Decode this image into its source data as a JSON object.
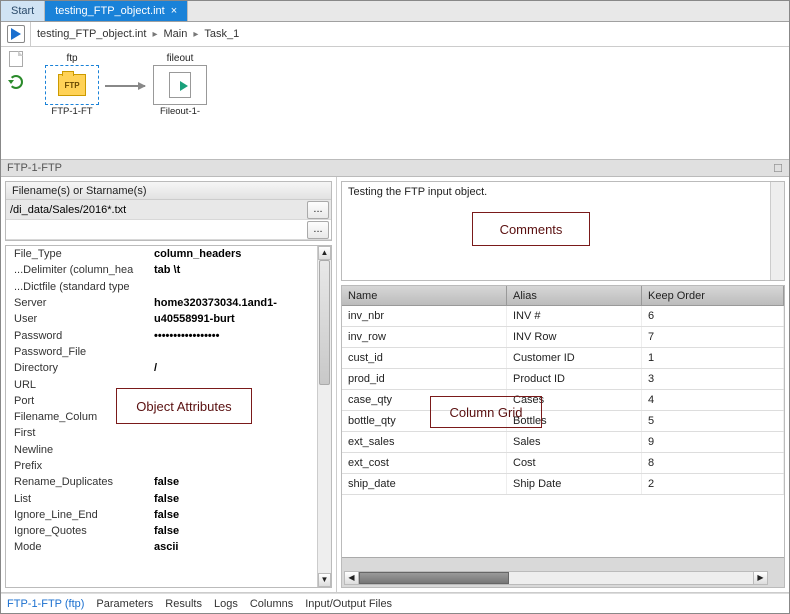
{
  "tabs": {
    "start": "Start",
    "active": "testing_FTP_object.int",
    "close_glyph": "×"
  },
  "breadcrumb": {
    "file": "testing_FTP_object.int",
    "seg1": "Main",
    "seg2": "Task_1",
    "sep": "▸"
  },
  "canvas": {
    "node_ftp": {
      "title": "ftp",
      "foot": "FTP-1-FT",
      "glyph": "FTP"
    },
    "node_fileout": {
      "title": "fileout",
      "foot": "Fileout-1-"
    }
  },
  "section_title": "FTP-1-FTP",
  "pin_glyph": "☐",
  "filenames": {
    "header": "Filename(s) or Starname(s)",
    "row1": "/di_data/Sales/2016*.txt",
    "row2": "",
    "dots": "..."
  },
  "attributes": [
    {
      "key": "File_Type",
      "val": "column_headers"
    },
    {
      "key": "...Delimiter (column_hea",
      "val": "tab  \\t"
    },
    {
      "key": "...Dictfile (standard type",
      "val": ""
    },
    {
      "key": "Server",
      "val": "home320373034.1and1-"
    },
    {
      "key": "User",
      "val": "u40558991-burt"
    },
    {
      "key": "Password",
      "val": "•••••••••••••••••"
    },
    {
      "key": "Password_File",
      "val": ""
    },
    {
      "key": "Directory",
      "val": "/"
    },
    {
      "key": "URL",
      "val": ""
    },
    {
      "key": "Port",
      "val": ""
    },
    {
      "key": "Filename_Colum",
      "val": ""
    },
    {
      "key": "First",
      "val": ""
    },
    {
      "key": "Newline",
      "val": ""
    },
    {
      "key": "Prefix",
      "val": ""
    },
    {
      "key": "Rename_Duplicates",
      "val": "false"
    },
    {
      "key": "List",
      "val": "false"
    },
    {
      "key": "Ignore_Line_End",
      "val": "false"
    },
    {
      "key": "Ignore_Quotes",
      "val": "false"
    },
    {
      "key": "Mode",
      "val": "ascii"
    }
  ],
  "comments_text": "Testing the FTP input object.",
  "grid": {
    "headers": {
      "name": "Name",
      "alias": "Alias",
      "keep": "Keep Order"
    },
    "rows": [
      {
        "name": "inv_nbr",
        "alias": "INV #",
        "keep": "6"
      },
      {
        "name": "inv_row",
        "alias": "INV Row",
        "keep": "7"
      },
      {
        "name": "cust_id",
        "alias": "Customer ID",
        "keep": "1"
      },
      {
        "name": "prod_id",
        "alias": "Product ID",
        "keep": "3"
      },
      {
        "name": "case_qty",
        "alias": "Cases",
        "keep": "4"
      },
      {
        "name": "bottle_qty",
        "alias": "Bottles",
        "keep": "5"
      },
      {
        "name": "ext_sales",
        "alias": "Sales",
        "keep": "9"
      },
      {
        "name": "ext_cost",
        "alias": "Cost",
        "keep": "8"
      },
      {
        "name": "ship_date",
        "alias": "Ship Date",
        "keep": "2"
      }
    ]
  },
  "annotations": {
    "comments": "Comments",
    "attributes": "Object Attributes",
    "grid": "Column Grid"
  },
  "bottom_tabs": [
    "FTP-1-FTP (ftp)",
    "Parameters",
    "Results",
    "Logs",
    "Columns",
    "Input/Output Files"
  ],
  "scroll_glyphs": {
    "up": "▲",
    "down": "▼",
    "left": "◀",
    "right": "▶"
  }
}
